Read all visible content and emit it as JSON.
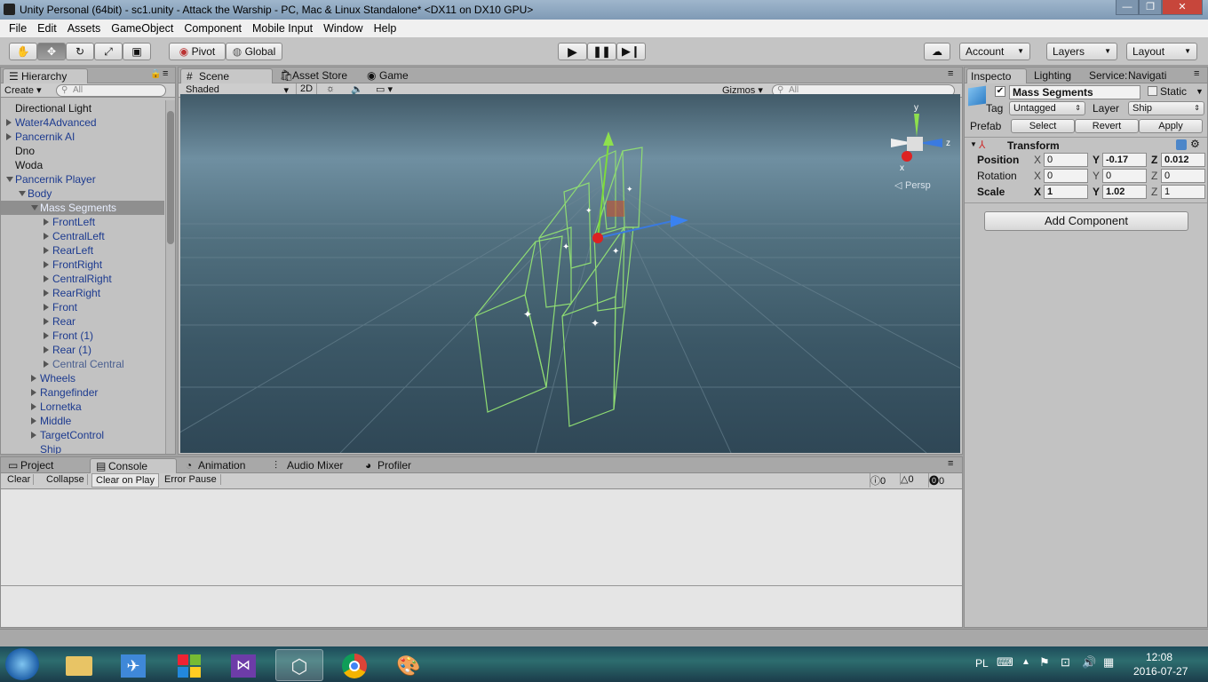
{
  "window": {
    "title": "Unity Personal (64bit) - sc1.unity - Attack the Warship - PC, Mac & Linux Standalone* <DX11 on DX10 GPU>",
    "minimize": "—",
    "maximize": "❐",
    "close": "✕"
  },
  "menu": [
    "File",
    "Edit",
    "Assets",
    "GameObject",
    "Component",
    "Mobile Input",
    "Window",
    "Help"
  ],
  "toolbar": {
    "pivot": "Pivot",
    "global": "Global",
    "account": "Account",
    "layers": "Layers",
    "layout": "Layout"
  },
  "hierarchy": {
    "tab": "Hierarchy",
    "create": "Create",
    "search_placeholder": "All",
    "items": [
      {
        "label": "Directional Light",
        "depth": 0,
        "blue": false,
        "arrow": "none"
      },
      {
        "label": "Water4Advanced",
        "depth": 0,
        "blue": true,
        "arrow": "right"
      },
      {
        "label": "Pancernik AI",
        "depth": 0,
        "blue": true,
        "arrow": "right"
      },
      {
        "label": "Dno",
        "depth": 0,
        "blue": false,
        "arrow": "none"
      },
      {
        "label": "Woda",
        "depth": 0,
        "blue": false,
        "arrow": "none"
      },
      {
        "label": "Pancernik Player",
        "depth": 0,
        "blue": true,
        "arrow": "down"
      },
      {
        "label": "Body",
        "depth": 1,
        "blue": true,
        "arrow": "down"
      },
      {
        "label": "Mass Segments",
        "depth": 2,
        "blue": true,
        "arrow": "down",
        "selected": true
      },
      {
        "label": "FrontLeft",
        "depth": 3,
        "blue": true,
        "arrow": "right"
      },
      {
        "label": "CentralLeft",
        "depth": 3,
        "blue": true,
        "arrow": "right"
      },
      {
        "label": "RearLeft",
        "depth": 3,
        "blue": true,
        "arrow": "right"
      },
      {
        "label": "FrontRight",
        "depth": 3,
        "blue": true,
        "arrow": "right"
      },
      {
        "label": "CentralRight",
        "depth": 3,
        "blue": true,
        "arrow": "right"
      },
      {
        "label": "RearRight",
        "depth": 3,
        "blue": true,
        "arrow": "right"
      },
      {
        "label": "Front",
        "depth": 3,
        "blue": true,
        "arrow": "right"
      },
      {
        "label": "Rear",
        "depth": 3,
        "blue": true,
        "arrow": "right"
      },
      {
        "label": "Front (1)",
        "depth": 3,
        "blue": true,
        "arrow": "right"
      },
      {
        "label": "Rear (1)",
        "depth": 3,
        "blue": true,
        "arrow": "right"
      },
      {
        "label": "Central Central",
        "depth": 3,
        "blue": true,
        "arrow": "right",
        "faded": true
      },
      {
        "label": "Wheels",
        "depth": 2,
        "blue": true,
        "arrow": "right"
      },
      {
        "label": "Rangefinder",
        "depth": 2,
        "blue": true,
        "arrow": "right"
      },
      {
        "label": "Lornetka",
        "depth": 2,
        "blue": true,
        "arrow": "right"
      },
      {
        "label": "Middle",
        "depth": 2,
        "blue": true,
        "arrow": "right"
      },
      {
        "label": "TargetControl",
        "depth": 2,
        "blue": true,
        "arrow": "right"
      },
      {
        "label": "Ship",
        "depth": 2,
        "blue": true,
        "arrow": "none"
      }
    ]
  },
  "scene": {
    "tabs": [
      "Scene",
      "Asset Store",
      "Game"
    ],
    "shading": "Shaded",
    "mode_2d": "2D",
    "gizmos": "Gizmos",
    "search_placeholder": "All",
    "gizmo_y": "y",
    "gizmo_z": "z",
    "gizmo_x": "x",
    "projection": "Persp"
  },
  "inspector": {
    "tabs": [
      "Inspecto",
      "Lighting",
      "Service:",
      "Navigati"
    ],
    "object_name": "Mass Segments",
    "static_label": "Static",
    "tag_label": "Tag",
    "tag_value": "Untagged",
    "layer_label": "Layer",
    "layer_value": "Ship",
    "prefab_label": "Prefab",
    "select": "Select",
    "revert": "Revert",
    "apply": "Apply",
    "transform_title": "Transform",
    "position": {
      "label": "Position",
      "x": "0",
      "y": "-0.17",
      "z": "0.012"
    },
    "rotation": {
      "label": "Rotation",
      "x": "0",
      "y": "0",
      "z": "0"
    },
    "scale": {
      "label": "Scale",
      "x": "1",
      "y": "1.02",
      "z": "1"
    },
    "axis_x": "X",
    "axis_y": "Y",
    "axis_z": "Z",
    "add_component": "Add Component"
  },
  "bottom": {
    "tabs": [
      "Project",
      "Console",
      "Animation",
      "Audio Mixer",
      "Profiler"
    ],
    "buttons": [
      "Clear",
      "Collapse",
      "Clear on Play",
      "Error Pause"
    ],
    "counts": {
      "log": "0",
      "warning": "0",
      "error": "0"
    }
  },
  "taskbar": {
    "lang": "PL",
    "time": "12:08",
    "date": "2016-07-27"
  },
  "colors": {
    "accent_blue": "#1c3a8f",
    "editor_gray": "#c2c2c2"
  }
}
